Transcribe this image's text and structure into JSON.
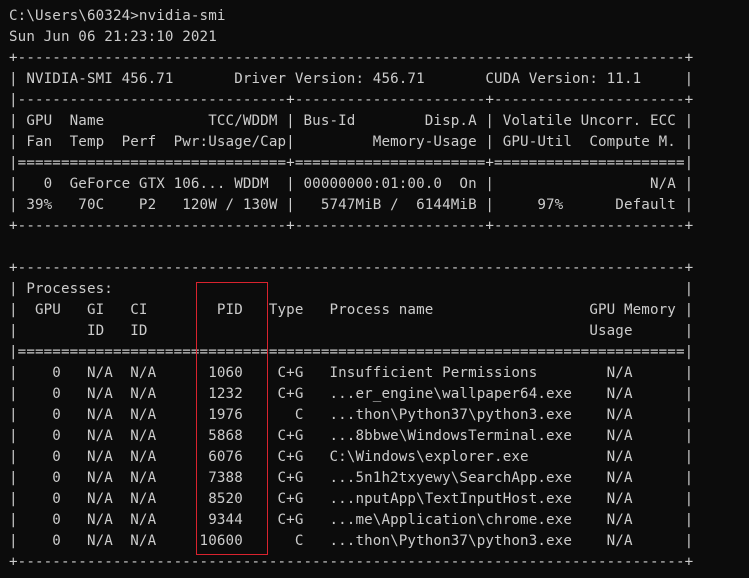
{
  "terminal": {
    "prompt_command": "C:\\Users\\60324>nvidia-smi",
    "timestamp": "Sun Jun 06 21:23:10 2021",
    "border_top": "+-----------------------------------------------------------------------------+",
    "header_row": "| NVIDIA-SMI 456.71       Driver Version: 456.71       CUDA Version: 11.1     |",
    "separator_header": "|-------------------------------+----------------------+----------------------+",
    "gpu_col_header_1": "| GPU  Name            TCC/WDDM | Bus-Id        Disp.A | Volatile Uncorr. ECC |",
    "gpu_col_header_2": "| Fan  Temp  Perf  Pwr:Usage/Cap|         Memory-Usage | GPU-Util  Compute M. |",
    "double_separator_gpu": "|===============================+======================+======================|",
    "gpu_row_1": "|   0  GeForce GTX 106... WDDM  | 00000000:01:00.0  On |                  N/A |",
    "gpu_row_2": "| 39%   70C    P2   120W / 130W |   5747MiB /  6144MiB |     97%      Default |",
    "border_gpu_bottom": "+-------------------------------+----------------------+----------------------+",
    "blank": "",
    "border_proc_top": "+-----------------------------------------------------------------------------+",
    "processes_title": "| Processes:                                                                  |",
    "proc_header_1": "|  GPU   GI   CI        PID   Type   Process name                  GPU Memory |",
    "proc_header_2": "|        ID   ID                                                   Usage      |",
    "double_separator_proc": "|=============================================================================|",
    "process_rows": [
      "|    0   N/A  N/A      1060    C+G   Insufficient Permissions        N/A      |",
      "|    0   N/A  N/A      1232    C+G   ...er_engine\\wallpaper64.exe    N/A      |",
      "|    0   N/A  N/A      1976      C   ...thon\\Python37\\python3.exe    N/A      |",
      "|    0   N/A  N/A      5868    C+G   ...8bbwe\\WindowsTerminal.exe    N/A      |",
      "|    0   N/A  N/A      6076    C+G   C:\\Windows\\explorer.exe         N/A      |",
      "|    0   N/A  N/A      7388    C+G   ...5n1h2txyewy\\SearchApp.exe    N/A      |",
      "|    0   N/A  N/A      8520    C+G   ...nputApp\\TextInputHost.exe    N/A      |",
      "|    0   N/A  N/A      9344    C+G   ...me\\Application\\chrome.exe    N/A      |",
      "|    0   N/A  N/A     10600      C   ...thon\\Python37\\python3.exe    N/A      |"
    ],
    "border_proc_bottom": "+-----------------------------------------------------------------------------+"
  },
  "colors": {
    "background": "#0c0c0c",
    "text": "#cccccc",
    "highlight_box": "#d9232e"
  }
}
